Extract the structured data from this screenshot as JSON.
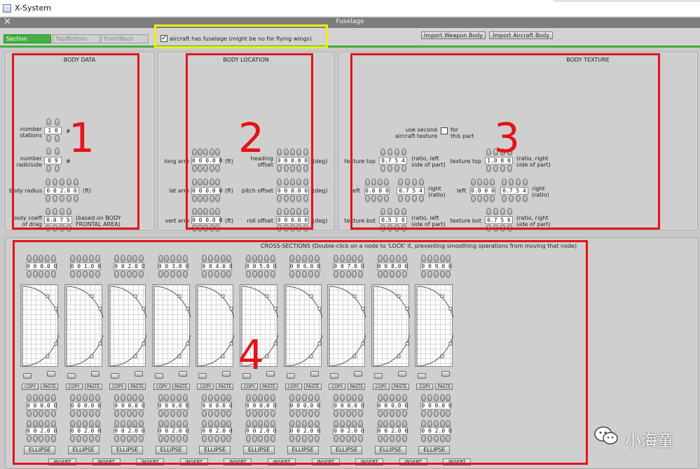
{
  "window": {
    "title": "X-System",
    "close_glyph": "✕",
    "subtitle": "Fuselage"
  },
  "tabs": [
    {
      "label": "Section",
      "active": true
    },
    {
      "label": "Top/Bottom",
      "active": false
    },
    {
      "label": "Front/Back",
      "active": false
    }
  ],
  "fuselage_check": {
    "checked": true,
    "glyph": "✔",
    "label": "aircraft has fuselage (might be no for flying wings)"
  },
  "buttons": {
    "import_weapon": "Import Weapon Body",
    "import_aircraft": "Import Aircraft Body"
  },
  "body_data": {
    "title": "BODY DATA",
    "stations": {
      "label": "number\nstations",
      "value": "1 0",
      "unit": "#"
    },
    "radii": {
      "label": "number\nradii/side",
      "value": "0 9",
      "unit": "#"
    },
    "radius": {
      "label": "body radius",
      "value": "0 0 2.0 0",
      "unit": "(ft)"
    },
    "drag": {
      "label": "body coeff\nof drag",
      "value": "0.0 7 5",
      "unit": "(based on BODY\nFRONTAL AREA)"
    }
  },
  "body_location": {
    "title": "BODY LOCATION",
    "long_arm": {
      "label": "long arm",
      "value": "0 0 0.0 0",
      "unit": "(ft)"
    },
    "lat_arm": {
      "label": "lat arm",
      "value": "0 0 0.0 0",
      "unit": "(ft)"
    },
    "vert_arm": {
      "label": "vert arm",
      "value": "0 0 0.0 0",
      "unit": "(ft)"
    },
    "heading": {
      "label": "heading\noffset",
      "value": "0 0 0.0 0",
      "unit": "(deg)"
    },
    "pitch": {
      "label": "pitch offset",
      "value": "0 0 0.0 0",
      "unit": "(deg)"
    },
    "roll": {
      "label": "roll offset",
      "value": "0 0 0.0 0",
      "unit": "(deg)"
    }
  },
  "body_texture": {
    "title": "BODY TEXTURE",
    "second_texture": {
      "label_left": "use second\naircraft texture",
      "label_right": "for\nthis part"
    },
    "rows": [
      {
        "l_label": "texture top",
        "l_v1": "0.7 5 4",
        "l_note": "(ratio, left\nside of part)",
        "r_label": "texture top",
        "r_v1": "1.0 0 0",
        "r_note": "(ratio, right\nside of part)"
      },
      {
        "l_label": "left",
        "l_v1": "0.0 0 0",
        "l_v2": "0.7 5 4",
        "l_note": "right\n(ratio)",
        "r_label": "left",
        "r_v1": "0.0 0 0",
        "r_v2": "0.7 5 4",
        "r_note": "right\n(ratio)"
      },
      {
        "l_label": "texture bot",
        "l_v1": "0.5 1 0",
        "l_note": "(ratio, left\nside of part)",
        "r_label": "texture bot",
        "r_v1": "0.7 5 6",
        "r_note": "(ratio, right\nside of part)"
      }
    ]
  },
  "cross_sections": {
    "title": "CROSS-SECTIONS (Double-click on a node to 'LOCK' it, preventing smoothing operations from moving that node)",
    "stations": [
      "0 0 0.0 0",
      "0 0 1.0 0",
      "0 0 2.0 0",
      "0 0 3.0 0",
      "0 0 4.0 0",
      "0 0 5.0 0",
      "0 0 6.0 0",
      "0 0 7.0 0",
      "0 0 8.0 0",
      "0 0 9.0 0"
    ],
    "row2_values": [
      "0 0 0.0 0",
      "0 0 0.0 0",
      "0 0 0.0 0",
      "0 0 0.0 0",
      "0 0 0.0 0",
      "0 0 0.0 0",
      "0 0 0.0 0",
      "0 0 0.0 0",
      "0 0 0.0 0",
      "0 0 0.0 0"
    ],
    "row3_values": [
      "0 0 2.0 0",
      "0 0 2.0 0",
      "0 0 2.0 0",
      "0 0 2.0 0",
      "0 0 2.0 0",
      "0 0 2.0 0",
      "0 0 2.0 0",
      "0 0 2.0 0",
      "0 0 2.0 0",
      "0 0 2.0 0"
    ],
    "copy": "COPY",
    "paste": "PASTE",
    "ellipse": "ELLIPSE",
    "insert": "INSERT"
  },
  "annotations": {
    "n1": "1",
    "n2": "2",
    "n3": "3",
    "n4": "4",
    "colors": {
      "red": "#e3141b",
      "yellow": "#f1ed0c",
      "green": "#43b143"
    }
  },
  "watermark": {
    "text": "小海童"
  }
}
